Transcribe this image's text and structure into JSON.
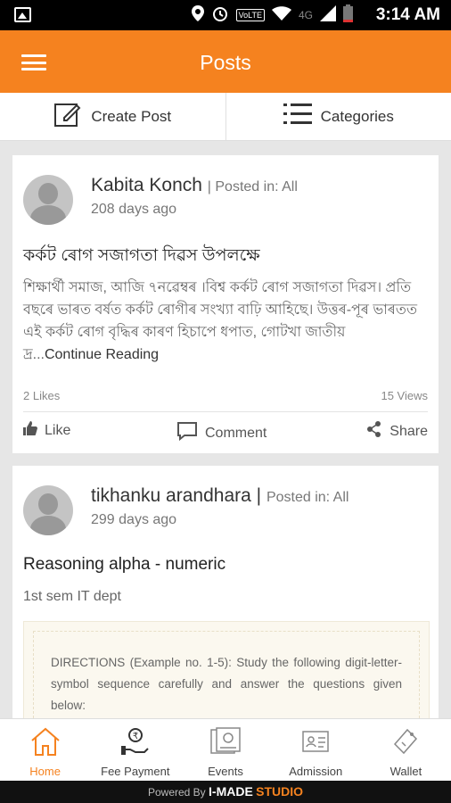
{
  "status_bar": {
    "time": "3:14 AM",
    "network": "4G",
    "lte": "VoLTE"
  },
  "app_bar": {
    "title": "Posts"
  },
  "actions": {
    "create_post": "Create Post",
    "categories": "Categories"
  },
  "posts": [
    {
      "author": "Kabita Konch",
      "posted_in": "| Posted in: All",
      "ago": "208 days ago",
      "title": "কৰ্কট ৰোগ সজাগতা দিৱস উপলক্ষে",
      "body": "শিক্ষাৰ্থী সমাজ, আজি ৭নৱেম্বৰ ।বিশ্ব কৰ্কট ৰোগ সজাগতা দিৱস। প্ৰতি বছৰে ভাৰত বৰ্ষত কৰ্কট ৰোগীৰ সংখ্যা বাঢ়ি আহিছে। উত্তৰ-পূৰ ভাৰতত এই কৰ্কট ৰোগ বৃদ্ধিৰ কাৰণ হিচাপে ধপাত, গোটখা জাতীয় দ্ৰ...",
      "continue": "Continue Reading",
      "likes": "2 Likes",
      "views": "15 Views",
      "like_label": "Like",
      "comment_label": "Comment",
      "share_label": "Share"
    },
    {
      "author": "tikhanku arandhara |",
      "posted_in": "Posted in: All",
      "ago": "299 days ago",
      "title": "Reasoning alpha - numeric",
      "subtitle": "1st sem IT dept",
      "preview_text": "DIRECTIONS (Example no. 1-5): Study the following digit-letter-symbol sequence carefully and answer the questions given below:"
    }
  ],
  "bottom_nav": [
    {
      "label": "Home",
      "icon": "home-icon",
      "active": true
    },
    {
      "label": "Fee Payment",
      "icon": "fee-payment-icon",
      "active": false
    },
    {
      "label": "Events",
      "icon": "events-icon",
      "active": false
    },
    {
      "label": "Admission",
      "icon": "admission-icon",
      "active": false
    },
    {
      "label": "Wallet",
      "icon": "wallet-icon",
      "active": false
    }
  ],
  "footer": {
    "powered_by": "Powered By",
    "brand": "I-MADE",
    "brand2": "STUDIO"
  },
  "colors": {
    "accent": "#f5821f"
  }
}
